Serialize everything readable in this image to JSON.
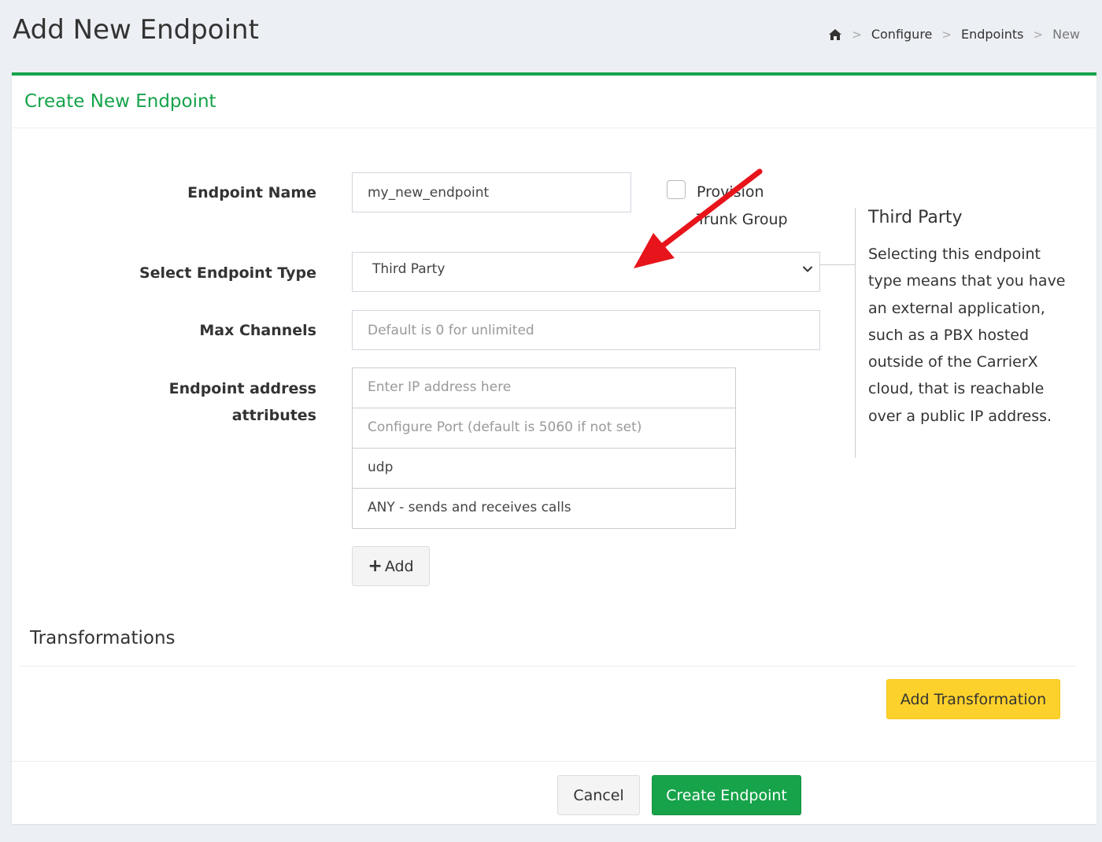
{
  "header": {
    "title": "Add New Endpoint",
    "breadcrumb": {
      "home_icon": "home-icon",
      "separator": ">",
      "items": [
        "Configure",
        "Endpoints",
        "New"
      ]
    }
  },
  "card": {
    "title": "Create New Endpoint",
    "accent_color": "#16a34a"
  },
  "form": {
    "endpoint_name": {
      "label": "Endpoint Name",
      "value": "my_new_endpoint"
    },
    "provision_trunk_group": {
      "label_line1": "Provision",
      "label_line2": "Trunk Group",
      "checked": false
    },
    "endpoint_type": {
      "label": "Select Endpoint Type",
      "selected": "Third Party"
    },
    "max_channels": {
      "label": "Max Channels",
      "placeholder": "Default is 0 for unlimited"
    },
    "address": {
      "label_line1": "Endpoint address",
      "label_line2": "attributes",
      "ip_placeholder": "Enter IP address here",
      "port_placeholder": "Configure Port (default is 5060 if not set)",
      "transport": "udp",
      "direction": "ANY - sends and receives calls"
    },
    "add_button": "Add"
  },
  "info": {
    "title": "Third Party",
    "text": "Selecting this endpoint type means that you have an external application, such as a PBX hosted outside of the CarrierX cloud, that is reachable over a public IP address."
  },
  "transformations": {
    "title": "Transformations",
    "add_button": "Add Transformation"
  },
  "footer": {
    "cancel": "Cancel",
    "create": "Create Endpoint"
  },
  "colors": {
    "success": "#16a34a",
    "warning": "#fdd12b",
    "annotation_arrow": "#e8141b"
  }
}
